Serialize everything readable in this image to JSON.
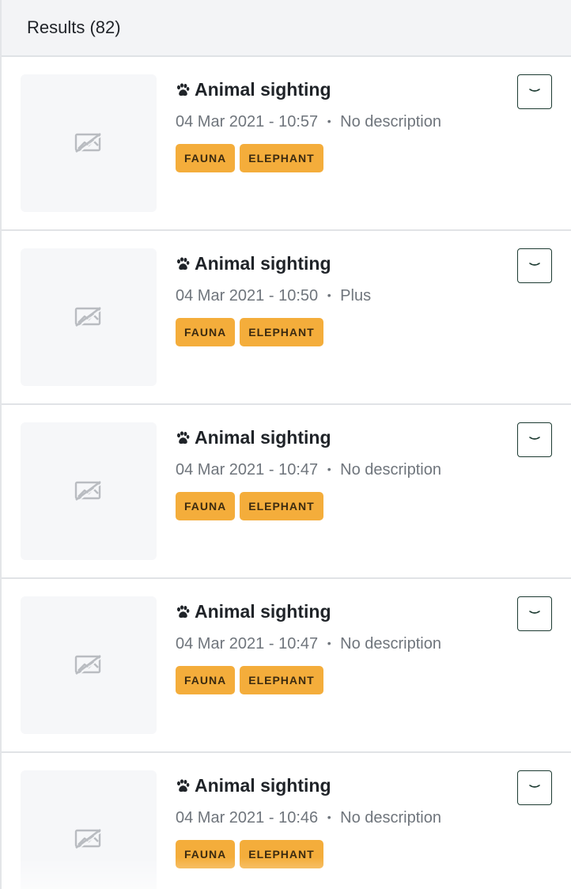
{
  "header": {
    "title": "Results (82)"
  },
  "icons": {
    "title_icon": "paw-icon",
    "thumbnail_icon": "image-unavailable-icon",
    "expand_icon": "chevron-down-icon"
  },
  "colors": {
    "tag_background": "#f4ad3b",
    "button_border": "#1d3b32",
    "header_background": "#f3f4f6"
  },
  "results": [
    {
      "title": "Animal sighting",
      "datetime": "04 Mar 2021 - 10:57",
      "description": "No description",
      "tags": [
        "FAUNA",
        "ELEPHANT"
      ]
    },
    {
      "title": "Animal sighting",
      "datetime": "04 Mar 2021 - 10:50",
      "description": "Plus",
      "tags": [
        "FAUNA",
        "ELEPHANT"
      ]
    },
    {
      "title": "Animal sighting",
      "datetime": "04 Mar 2021 - 10:47",
      "description": "No description",
      "tags": [
        "FAUNA",
        "ELEPHANT"
      ]
    },
    {
      "title": "Animal sighting",
      "datetime": "04 Mar 2021 - 10:47",
      "description": "No description",
      "tags": [
        "FAUNA",
        "ELEPHANT"
      ]
    },
    {
      "title": "Animal sighting",
      "datetime": "04 Mar 2021 - 10:46",
      "description": "No description",
      "tags": [
        "FAUNA",
        "ELEPHANT"
      ]
    }
  ]
}
